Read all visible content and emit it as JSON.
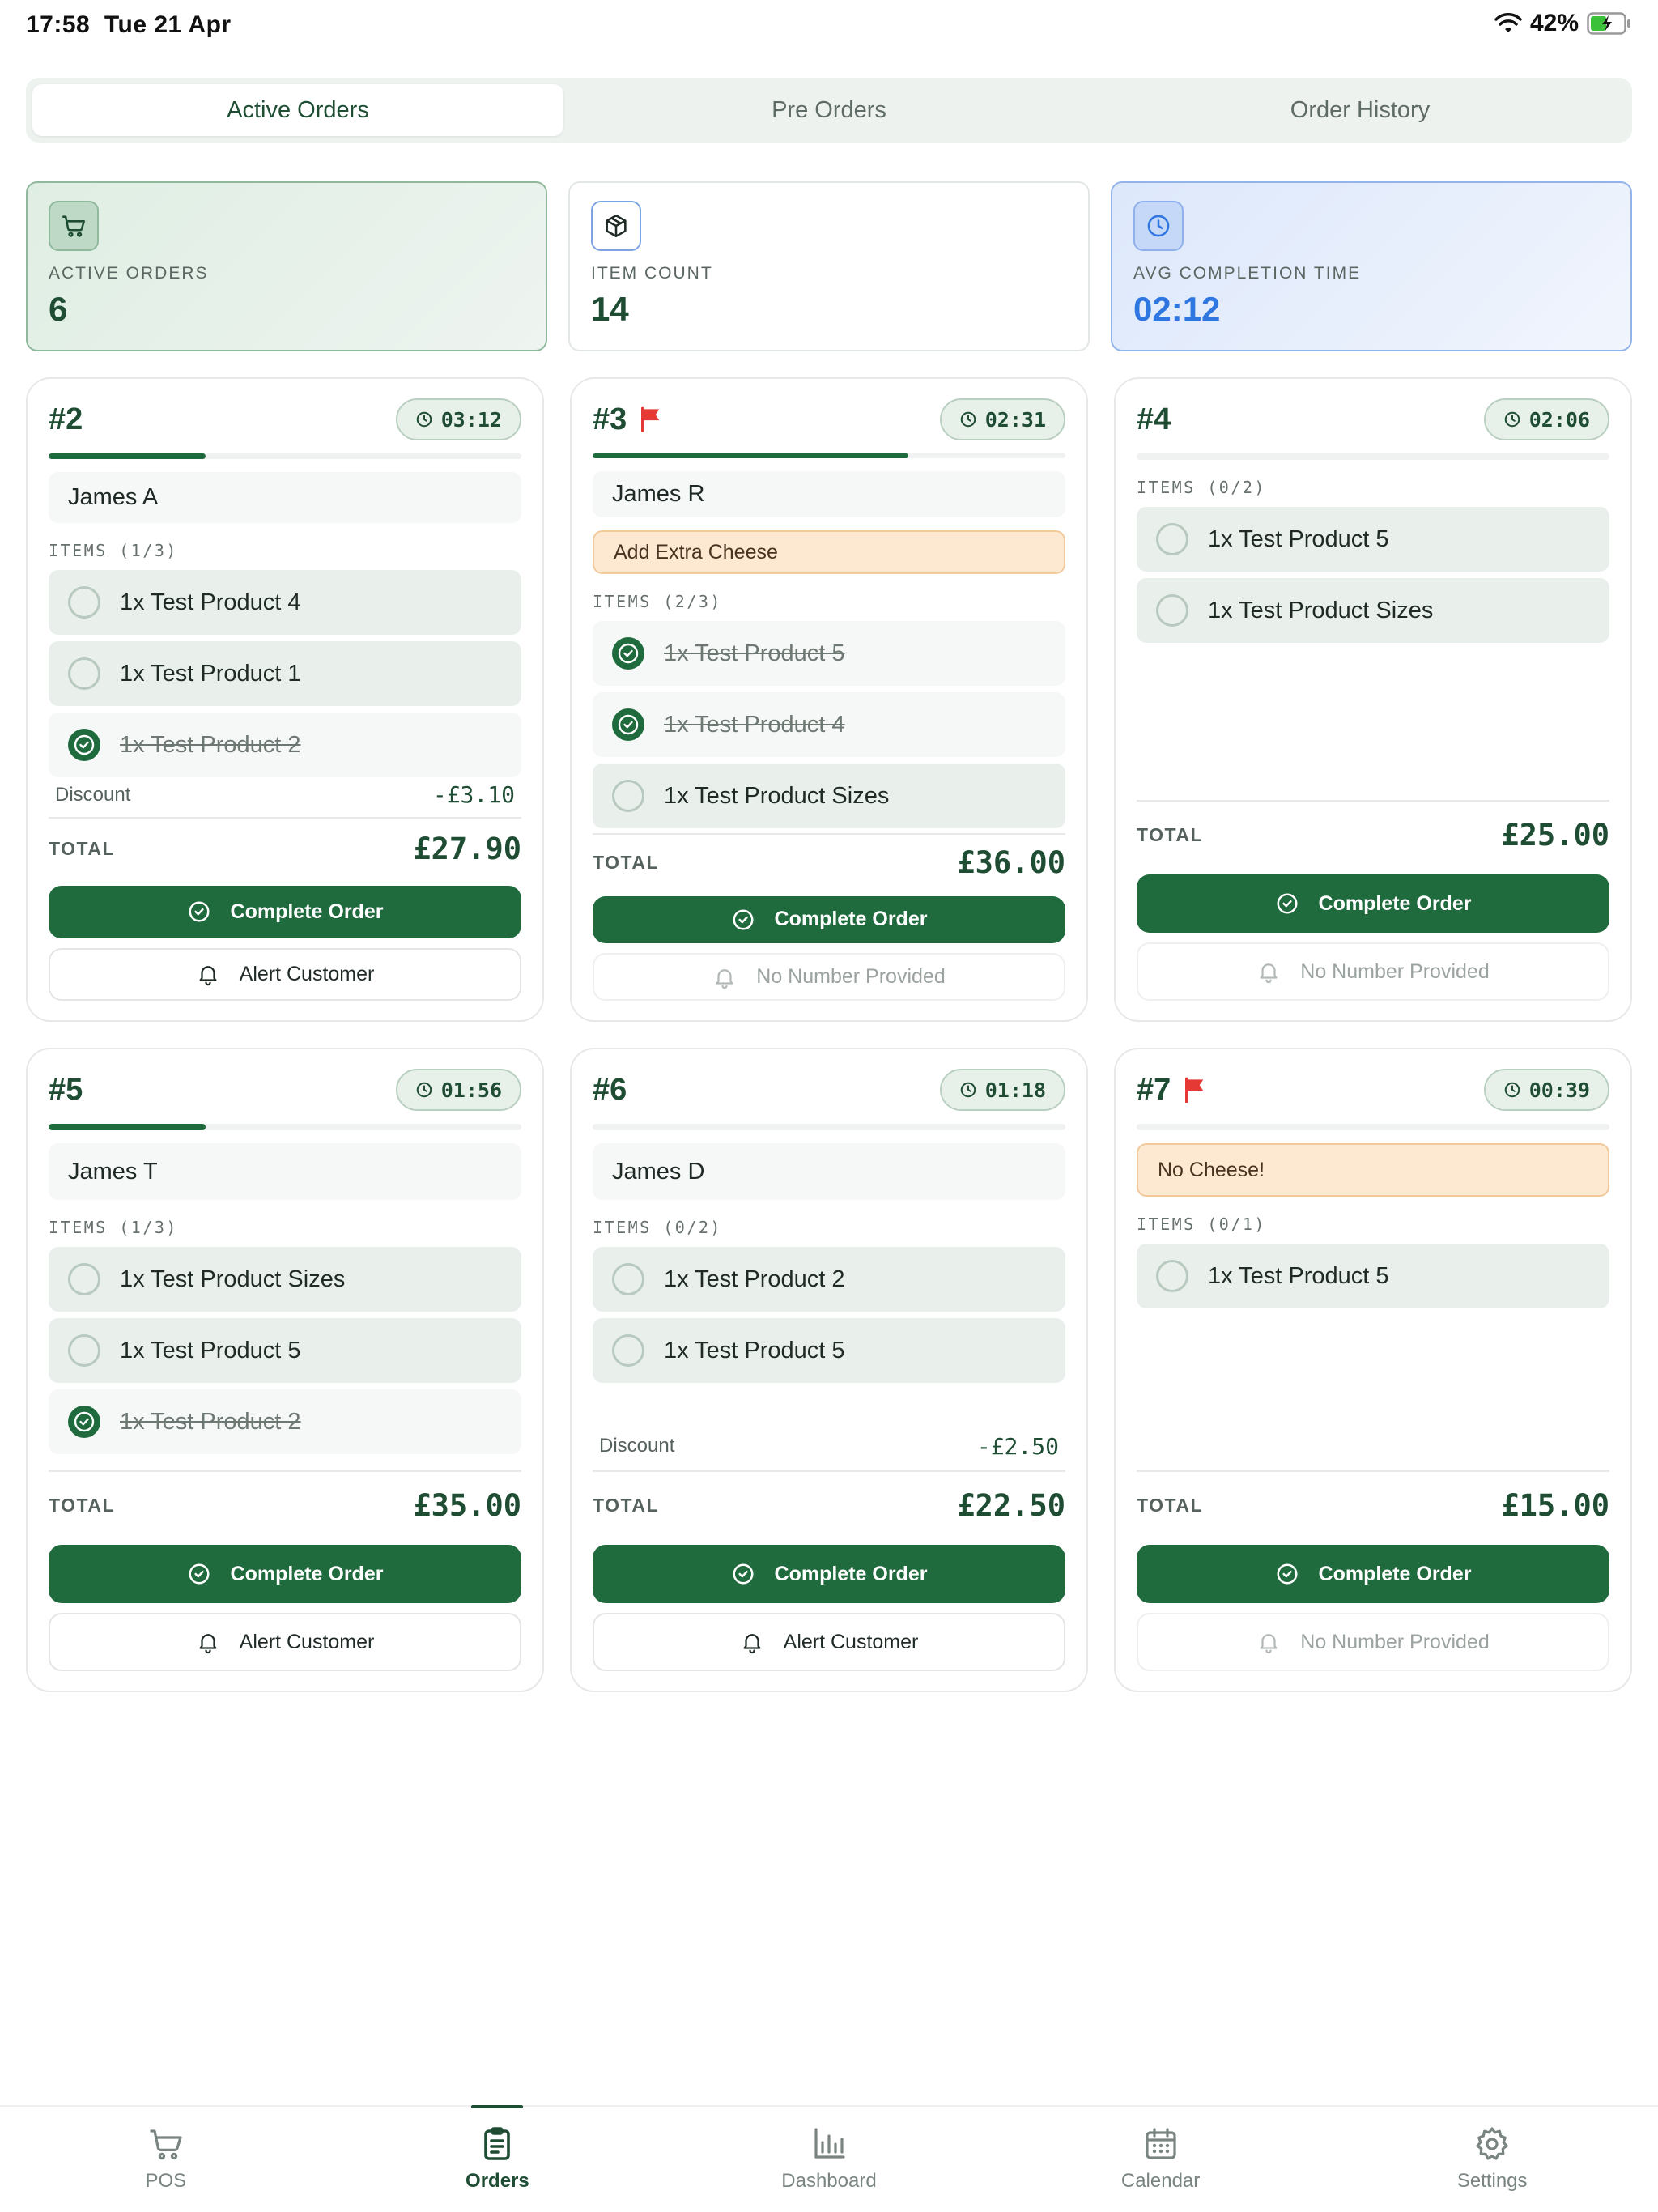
{
  "status_bar": {
    "time": "17:58",
    "date": "Tue 21 Apr",
    "battery": "42%"
  },
  "tabs": [
    {
      "label": "Active Orders",
      "active": true
    },
    {
      "label": "Pre Orders",
      "active": false
    },
    {
      "label": "Order History",
      "active": false
    }
  ],
  "stats": [
    {
      "label": "ACTIVE ORDERS",
      "value": "6",
      "icon": "cart-icon"
    },
    {
      "label": "ITEM COUNT",
      "value": "14",
      "icon": "box-icon"
    },
    {
      "label": "AVG COMPLETION TIME",
      "value": "02:12",
      "icon": "clock-icon"
    }
  ],
  "labels": {
    "total": "TOTAL",
    "discount": "Discount",
    "complete": "Complete Order",
    "alert": "Alert Customer",
    "no_number": "No Number Provided"
  },
  "orders": [
    {
      "number": "#2",
      "flagged": false,
      "timer": "03:12",
      "progress": 0.333,
      "customer": "James A",
      "note": null,
      "items_label": "ITEMS (1/3)",
      "items": [
        {
          "name": "1x Test Product 4",
          "done": false
        },
        {
          "name": "1x Test Product 1",
          "done": false
        },
        {
          "name": "1x Test Product 2",
          "done": true
        }
      ],
      "discount": "-£3.10",
      "total": "£27.90",
      "can_alert": true
    },
    {
      "number": "#3",
      "flagged": true,
      "timer": "02:31",
      "progress": 0.667,
      "customer": "James R",
      "note": "Add Extra Cheese",
      "items_label": "ITEMS (2/3)",
      "items": [
        {
          "name": "1x Test Product 5",
          "done": true
        },
        {
          "name": "1x Test Product 4",
          "done": true
        },
        {
          "name": "1x Test Product Sizes",
          "done": false
        }
      ],
      "discount": null,
      "total": "£36.00",
      "can_alert": false
    },
    {
      "number": "#4",
      "flagged": false,
      "timer": "02:06",
      "progress": 0,
      "customer": null,
      "note": null,
      "items_label": "ITEMS (0/2)",
      "items": [
        {
          "name": "1x Test Product 5",
          "done": false
        },
        {
          "name": "1x Test Product Sizes",
          "done": false
        }
      ],
      "discount": null,
      "total": "£25.00",
      "can_alert": false
    },
    {
      "number": "#5",
      "flagged": false,
      "timer": "01:56",
      "progress": 0.333,
      "customer": "James T",
      "note": null,
      "items_label": "ITEMS (1/3)",
      "items": [
        {
          "name": "1x Test Product Sizes",
          "done": false
        },
        {
          "name": "1x Test Product 5",
          "done": false
        },
        {
          "name": "1x Test Product 2",
          "done": true
        }
      ],
      "discount": null,
      "total": "£35.00",
      "can_alert": true
    },
    {
      "number": "#6",
      "flagged": false,
      "timer": "01:18",
      "progress": 0,
      "customer": "James D",
      "note": null,
      "items_label": "ITEMS (0/2)",
      "items": [
        {
          "name": "1x Test Product 2",
          "done": false
        },
        {
          "name": "1x Test Product 5",
          "done": false
        }
      ],
      "discount": "-£2.50",
      "total": "£22.50",
      "can_alert": true
    },
    {
      "number": "#7",
      "flagged": true,
      "timer": "00:39",
      "progress": 0,
      "customer": null,
      "note": "No Cheese!",
      "items_label": "ITEMS (0/1)",
      "items": [
        {
          "name": "1x Test Product 5",
          "done": false
        }
      ],
      "discount": null,
      "total": "£15.00",
      "can_alert": false
    }
  ],
  "nav": [
    {
      "label": "POS",
      "icon": "cart-icon",
      "active": false
    },
    {
      "label": "Orders",
      "icon": "clipboard-icon",
      "active": true
    },
    {
      "label": "Dashboard",
      "icon": "bar-chart-icon",
      "active": false
    },
    {
      "label": "Calendar",
      "icon": "calendar-icon",
      "active": false
    },
    {
      "label": "Settings",
      "icon": "gear-icon",
      "active": false
    }
  ],
  "colors": {
    "brand": "#1f6b3d",
    "accent_blue": "#2f76e0",
    "note_bg": "#fde9d2",
    "flag": "#e53935"
  }
}
